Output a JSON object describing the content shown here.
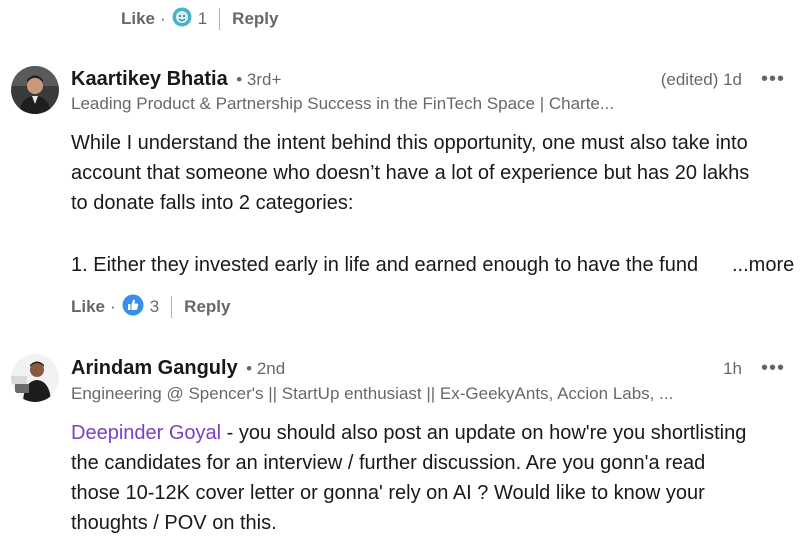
{
  "top_actions": {
    "like": "Like",
    "dot": "·",
    "reactions": "1",
    "reply": "Reply"
  },
  "comments": [
    {
      "name": "Kaartikey Bhatia",
      "degree": "• 3rd+",
      "headline": "Leading Product & Partnership Success in the FinTech Space | Charte...",
      "time": "(edited) 1d",
      "more_menu": "•••",
      "lines": [
        "While I understand the intent behind this opportunity, one must also take into",
        "account that someone who doesn’t have a lot of experience but has 20 lakhs",
        "to donate falls into 2 categories:",
        "1. Either they invested early in life and earned enough to have the fund"
      ],
      "see_more": "...more",
      "actions": {
        "like": "Like",
        "dot": "·",
        "reactions": "3",
        "reply": "Reply"
      }
    },
    {
      "name": "Arindam Ganguly",
      "degree": "• 2nd",
      "headline": "Engineering @ Spencer's || StartUp enthusiast || Ex-GeekyAnts, Accion Labs, ...",
      "time": "1h",
      "more_menu": "•••",
      "mention": "Deepinder Goyal",
      "lines": [
        " - you should also post an update on how're you shortlisting",
        "the candidates for an interview / further discussion. Are you gonn'a read",
        "those 10-12K cover letter or gonna' rely on AI ? Would like to know your",
        "thoughts / POV on this."
      ]
    }
  ],
  "colors": {
    "mention": "#7b40c4",
    "like_blue": "#378fe9",
    "support_teal": "#44b5c9"
  },
  "icons": {
    "top_reaction": "support-reaction-icon",
    "like_reaction": "like-reaction-icon"
  }
}
